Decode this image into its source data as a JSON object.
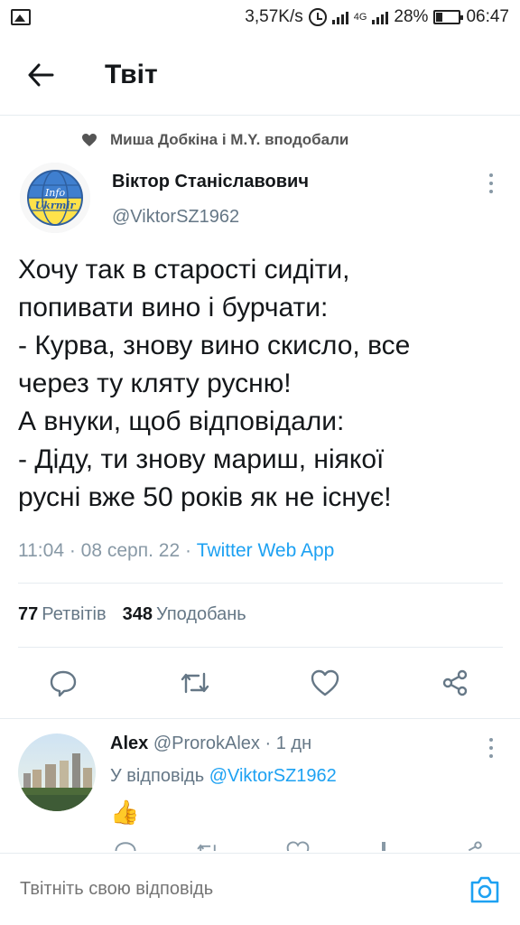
{
  "status_bar": {
    "network_speed": "3,57K/s",
    "network_type": "4G",
    "battery": "28%",
    "time": "06:47",
    "icons": [
      "image-icon",
      "alarm-icon",
      "signal-icon",
      "battery-icon"
    ]
  },
  "header": {
    "title": "Твіт",
    "back_icon": "arrow-left-icon"
  },
  "tweet": {
    "liked_by": "Миша Добкіна і M.Y. вподобали",
    "avatar_caption_1": "Info",
    "avatar_caption_2": "Ukrmir",
    "author_name": "Віктор Станіславович",
    "author_handle": "@ViktorSZ1962",
    "text": "Хочу так в старості сидіти,\nпопивати вино і бурчати:\n- Курва, знову вино скисло, все\nчерез ту кляту русню!\nА внуки, щоб відповідали:\n- Діду, ти знову мариш, ніякої\nрусні вже 50 років як не існує!",
    "time": "11:04",
    "date": "08 серп. 22",
    "source": "Twitter Web App",
    "retweets_count": "77",
    "retweets_label": "Ретвітів",
    "likes_count": "348",
    "likes_label": "Уподобань",
    "actions": [
      "reply-icon",
      "retweet-icon",
      "like-icon",
      "share-icon"
    ]
  },
  "reply": {
    "name": "Alex",
    "handle": "@ProrokAlex",
    "age": "1 дн",
    "reply_to_prefix": "У відповідь",
    "reply_to_handle": "@ViktorSZ1962",
    "text": "👍"
  },
  "compose": {
    "placeholder": "Твітніть свою відповідь"
  },
  "colors": {
    "accent": "#1da1f2",
    "text": "#14171a",
    "secondary": "#657786",
    "divider": "#e6ecf0"
  }
}
